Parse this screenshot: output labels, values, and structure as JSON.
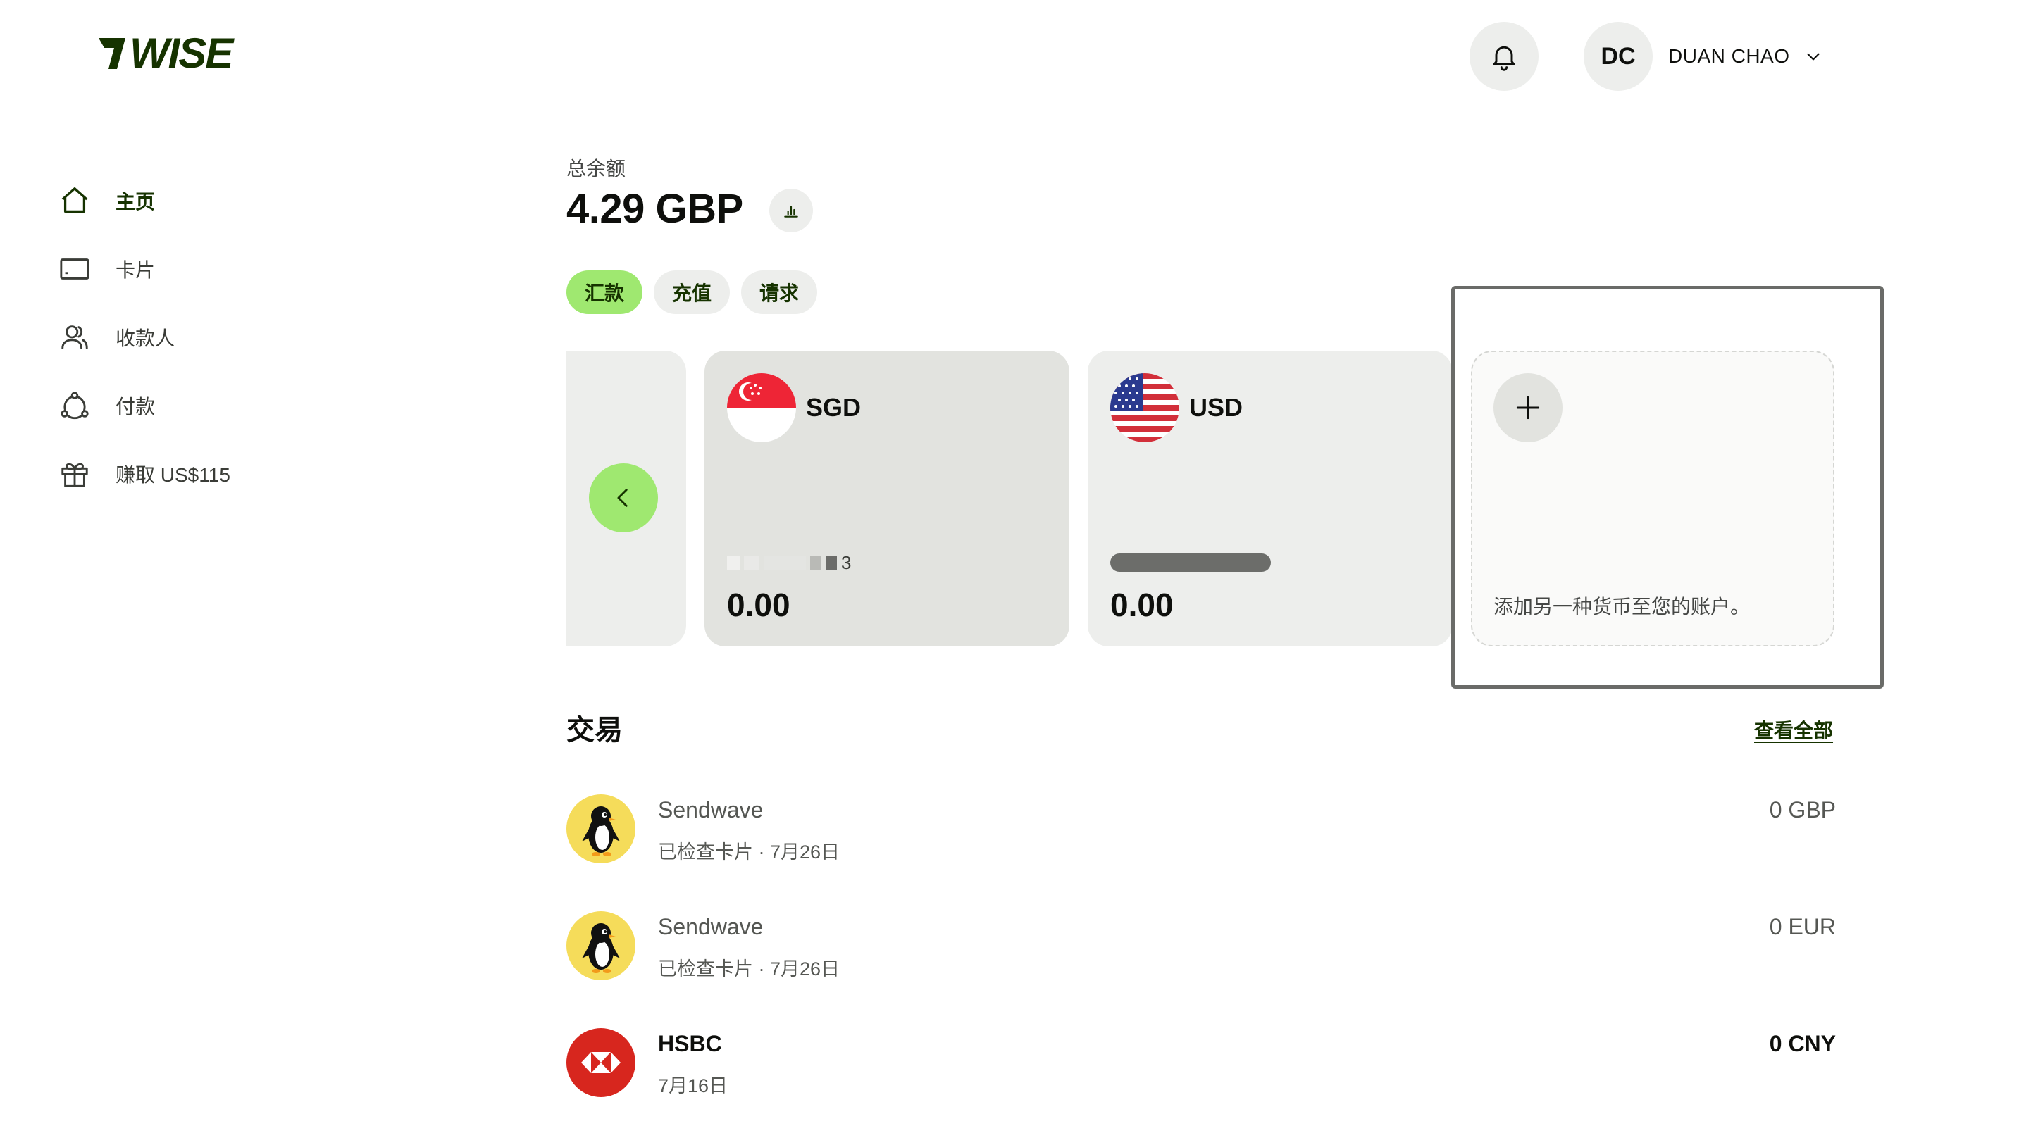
{
  "app": {
    "logo_text": "WISE",
    "colors": {
      "brand_dark": "#163300",
      "brand_green": "#9fe870",
      "surface": "#edeeec"
    }
  },
  "header": {
    "notification_icon": "bell-icon",
    "user": {
      "initials": "DC",
      "name": "DUAN CHAO",
      "menu_icon": "chevron-down-icon"
    }
  },
  "sidebar": {
    "items": [
      {
        "label": "主页",
        "icon": "home-icon",
        "active": true
      },
      {
        "label": "卡片",
        "icon": "card-icon",
        "active": false
      },
      {
        "label": "收款人",
        "icon": "recipients-icon",
        "active": false
      },
      {
        "label": "付款",
        "icon": "payments-icon",
        "active": false
      },
      {
        "label": "赚取 US$115",
        "icon": "gift-icon",
        "active": false
      }
    ]
  },
  "balance": {
    "caption": "总余额",
    "amount": "4.29 GBP",
    "chart_icon": "bar-chart-icon"
  },
  "actions": [
    {
      "label": "汇款",
      "primary": true
    },
    {
      "label": "充值",
      "primary": false
    },
    {
      "label": "请求",
      "primary": false
    }
  ],
  "currency_cards": [
    {
      "code": "SGD",
      "flag": "singapore-flag-icon",
      "account_suffix": "3",
      "amount": "0.00"
    },
    {
      "code": "USD",
      "flag": "us-flag-icon",
      "account_suffix": "",
      "amount": "0.00"
    }
  ],
  "add_currency": {
    "icon": "plus-icon",
    "text": "添加另一种货币至您的账户。"
  },
  "transactions": {
    "title": "交易",
    "view_all": "查看全部",
    "items": [
      {
        "name": "Sendwave",
        "subtitle": "已检查卡片 · 7月26日",
        "amount": "0 GBP",
        "logo": "sendwave-penguin-icon",
        "emphasis": false
      },
      {
        "name": "Sendwave",
        "subtitle": "已检查卡片 · 7月26日",
        "amount": "0 EUR",
        "logo": "sendwave-penguin-icon",
        "emphasis": false
      },
      {
        "name": "HSBC",
        "subtitle": "7月16日",
        "amount": "0 CNY",
        "logo": "hsbc-logo-icon",
        "emphasis": true
      }
    ]
  }
}
